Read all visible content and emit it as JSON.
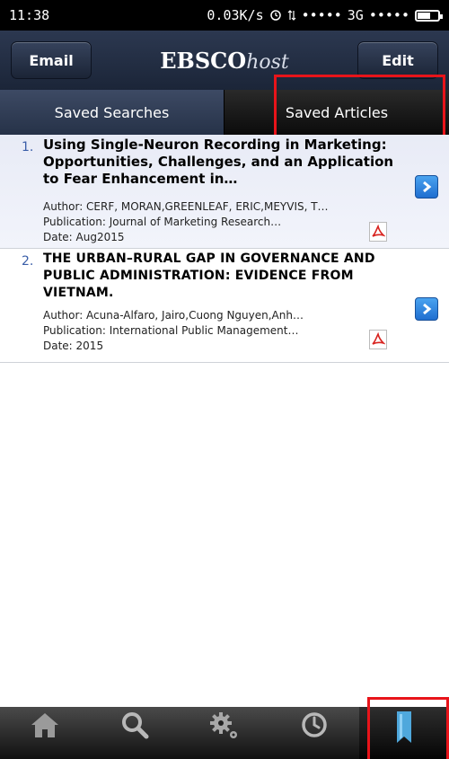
{
  "status_bar": {
    "time": "11:38",
    "network_speed": "0.03K/s",
    "signal_left": "•••••",
    "network_type": "3G",
    "signal_right": "•••••"
  },
  "header": {
    "email_label": "Email",
    "logo_main": "EBSCO",
    "logo_suffix": "host",
    "edit_label": "Edit"
  },
  "tabs": [
    {
      "label": "Saved Searches",
      "active": true
    },
    {
      "label": "Saved Articles",
      "active": false
    }
  ],
  "articles": [
    {
      "number": "1.",
      "title": "Using Single-Neuron Recording in Marketing: Opportunities, Challenges, and an Application to Fear Enhancement in…",
      "author": "Author: CERF, MORAN,GREENLEAF, ERIC,MEYVIS, T…",
      "publication": "Publication: Journal of Marketing Research…",
      "date": "Date: Aug2015"
    },
    {
      "number": "2.",
      "title": "THE URBAN–RURAL GAP IN GOVERNANCE AND PUBLIC ADMINISTRATION: EVIDENCE FROM VIETNAM.",
      "author": "Author: Acuna-Alfaro, Jairo,Cuong Nguyen,Anh…",
      "publication": "Publication: International Public Management…",
      "date": "Date: 2015"
    }
  ],
  "bottom_nav": [
    {
      "icon": "home-icon"
    },
    {
      "icon": "search-icon"
    },
    {
      "icon": "gear-icon"
    },
    {
      "icon": "clock-icon"
    },
    {
      "icon": "bookmark-icon",
      "active": true
    }
  ],
  "colors": {
    "highlight": "#e8141a",
    "bookmark": "#4fa8dc",
    "header_bg": "#1b2538"
  }
}
